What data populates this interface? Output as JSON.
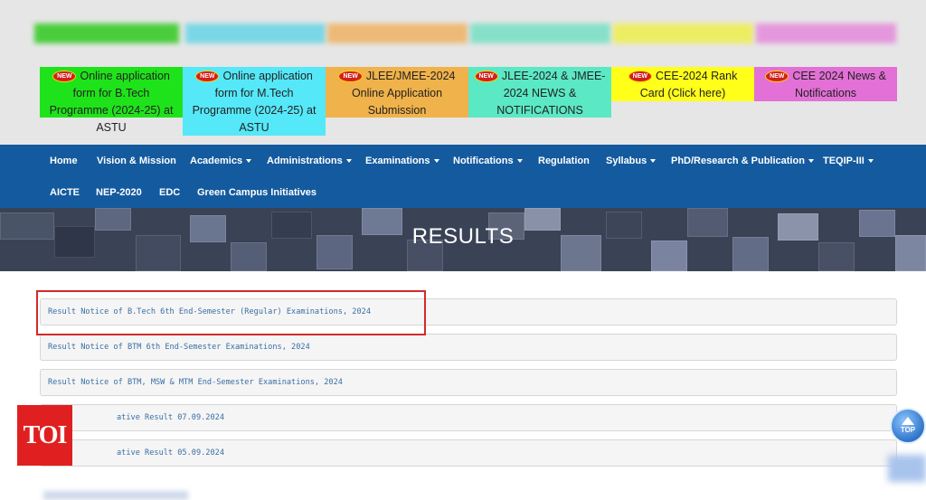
{
  "notices": [
    {
      "badge": "NEW",
      "text": "Online application form for B.Tech Programme (2024-25) at ASTU",
      "color": "#1fe31a"
    },
    {
      "badge": "NEW",
      "text": "Online application form for M.Tech Programme (2024-25) at ASTU",
      "color": "#55e8f8"
    },
    {
      "badge": "NEW",
      "text": "JLEE/JMEE-2024 Online Application Submission",
      "color": "#f0b24a"
    },
    {
      "badge": "NEW",
      "text": "JLEE-2024 & JMEE-2024 NEWS & NOTIFICATIONS",
      "color": "#5be8c4"
    },
    {
      "badge": "NEW",
      "text": "CEE-2024 Rank Card (Click here)",
      "color": "#ffff1a"
    },
    {
      "badge": "NEW",
      "text": "CEE 2024 News & Notifications",
      "color": "#e370d6"
    }
  ],
  "nav": {
    "home": "Home",
    "vision": "Vision & Mission",
    "academics": "Academics",
    "administrations": "Administrations",
    "examinations": "Examinations",
    "notifications": "Notifications",
    "regulation": "Regulation",
    "syllabus": "Syllabus",
    "phd": "PhD/Research & Publication",
    "teqip": "TEQIP-III",
    "aicte": "AICTE",
    "nep": "NEP-2020",
    "edc": "EDC",
    "green": "Green Campus Initiatives"
  },
  "banner": {
    "title": "RESULTS"
  },
  "results": [
    "Result Notice of B.Tech 6th End-Semester (Regular) Examinations, 2024",
    "Result Notice of BTM 6th End-Semester Examinations, 2024",
    "Result Notice of BTM, MSW & MTM End-Semester Examinations, 2024",
    "ative Result 07.09.2024",
    "ative Result 05.09.2024"
  ],
  "watermark": "TOI",
  "back_to_top": "TOP",
  "colors": {
    "nav_bg": "#145a9e",
    "highlight": "#d32a2a",
    "link": "#3a6ea5"
  }
}
